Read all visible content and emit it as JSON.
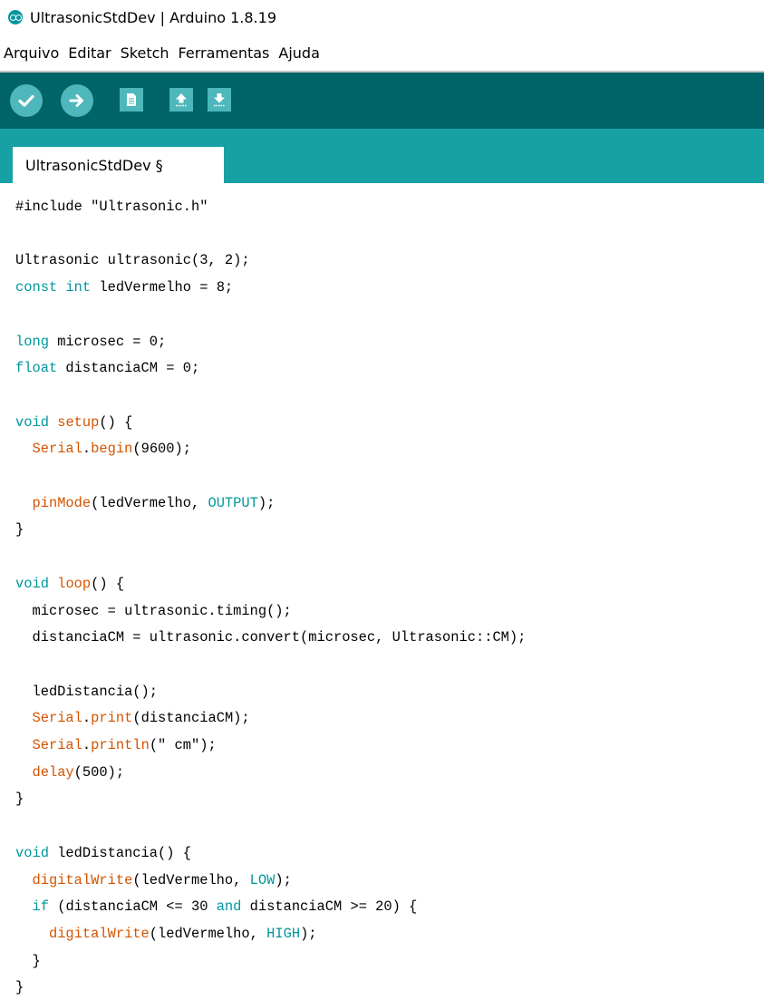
{
  "window": {
    "title": "UltrasonicStdDev | Arduino 1.8.19",
    "icon": "arduino-logo-icon"
  },
  "menu": {
    "items": [
      "Arquivo",
      "Editar",
      "Sketch",
      "Ferramentas",
      "Ajuda"
    ]
  },
  "toolbar": {
    "buttons": [
      "verify-icon",
      "upload-icon",
      "new-icon",
      "open-icon",
      "save-icon"
    ],
    "colors": {
      "bar": "#006468",
      "button": "#4db7bb"
    }
  },
  "tabs": [
    {
      "label": "UltrasonicStdDev §",
      "active": true
    }
  ],
  "colors": {
    "keyword": "#00979c",
    "function": "#d35400",
    "constant": "#00979c",
    "tabbar": "#17a1a5"
  },
  "code": [
    [
      [
        "p",
        "#include \"Ultrasonic.h\""
      ]
    ],
    [],
    [
      [
        "p",
        "Ultrasonic ultrasonic(3, 2);"
      ]
    ],
    [
      [
        "k",
        "const"
      ],
      [
        "p",
        " "
      ],
      [
        "k",
        "int"
      ],
      [
        "p",
        " ledVermelho = 8;"
      ]
    ],
    [],
    [
      [
        "k",
        "long"
      ],
      [
        "p",
        " microsec = 0;"
      ]
    ],
    [
      [
        "k",
        "float"
      ],
      [
        "p",
        " distanciaCM = 0;"
      ]
    ],
    [],
    [
      [
        "k",
        "void"
      ],
      [
        "p",
        " "
      ],
      [
        "f",
        "setup"
      ],
      [
        "p",
        "() {"
      ]
    ],
    [
      [
        "p",
        "  "
      ],
      [
        "f",
        "Serial"
      ],
      [
        "p",
        "."
      ],
      [
        "f",
        "begin"
      ],
      [
        "p",
        "(9600);"
      ]
    ],
    [],
    [
      [
        "p",
        "  "
      ],
      [
        "f",
        "pinMode"
      ],
      [
        "p",
        "(ledVermelho, "
      ],
      [
        "c",
        "OUTPUT"
      ],
      [
        "p",
        ");"
      ]
    ],
    [
      [
        "p",
        "}"
      ]
    ],
    [],
    [
      [
        "k",
        "void"
      ],
      [
        "p",
        " "
      ],
      [
        "f",
        "loop"
      ],
      [
        "p",
        "() {"
      ]
    ],
    [
      [
        "p",
        "  microsec = ultrasonic.timing();"
      ]
    ],
    [
      [
        "p",
        "  distanciaCM = ultrasonic.convert(microsec, Ultrasonic::CM);"
      ]
    ],
    [],
    [
      [
        "p",
        "  ledDistancia();"
      ]
    ],
    [
      [
        "p",
        "  "
      ],
      [
        "f",
        "Serial"
      ],
      [
        "p",
        "."
      ],
      [
        "f",
        "print"
      ],
      [
        "p",
        "(distanciaCM);"
      ]
    ],
    [
      [
        "p",
        "  "
      ],
      [
        "f",
        "Serial"
      ],
      [
        "p",
        "."
      ],
      [
        "f",
        "println"
      ],
      [
        "p",
        "(\" cm\");"
      ]
    ],
    [
      [
        "p",
        "  "
      ],
      [
        "f",
        "delay"
      ],
      [
        "p",
        "(500);"
      ]
    ],
    [
      [
        "p",
        "}"
      ]
    ],
    [],
    [
      [
        "k",
        "void"
      ],
      [
        "p",
        " ledDistancia() {"
      ]
    ],
    [
      [
        "p",
        "  "
      ],
      [
        "f",
        "digitalWrite"
      ],
      [
        "p",
        "(ledVermelho, "
      ],
      [
        "c",
        "LOW"
      ],
      [
        "p",
        ");"
      ]
    ],
    [
      [
        "p",
        "  "
      ],
      [
        "k",
        "if"
      ],
      [
        "p",
        " (distanciaCM <= 30 "
      ],
      [
        "k",
        "and"
      ],
      [
        "p",
        " distanciaCM >= 20) {"
      ]
    ],
    [
      [
        "p",
        "    "
      ],
      [
        "f",
        "digitalWrite"
      ],
      [
        "p",
        "(ledVermelho, "
      ],
      [
        "c",
        "HIGH"
      ],
      [
        "p",
        ");"
      ]
    ],
    [
      [
        "p",
        "  }"
      ]
    ],
    [
      [
        "p",
        "}"
      ]
    ]
  ]
}
